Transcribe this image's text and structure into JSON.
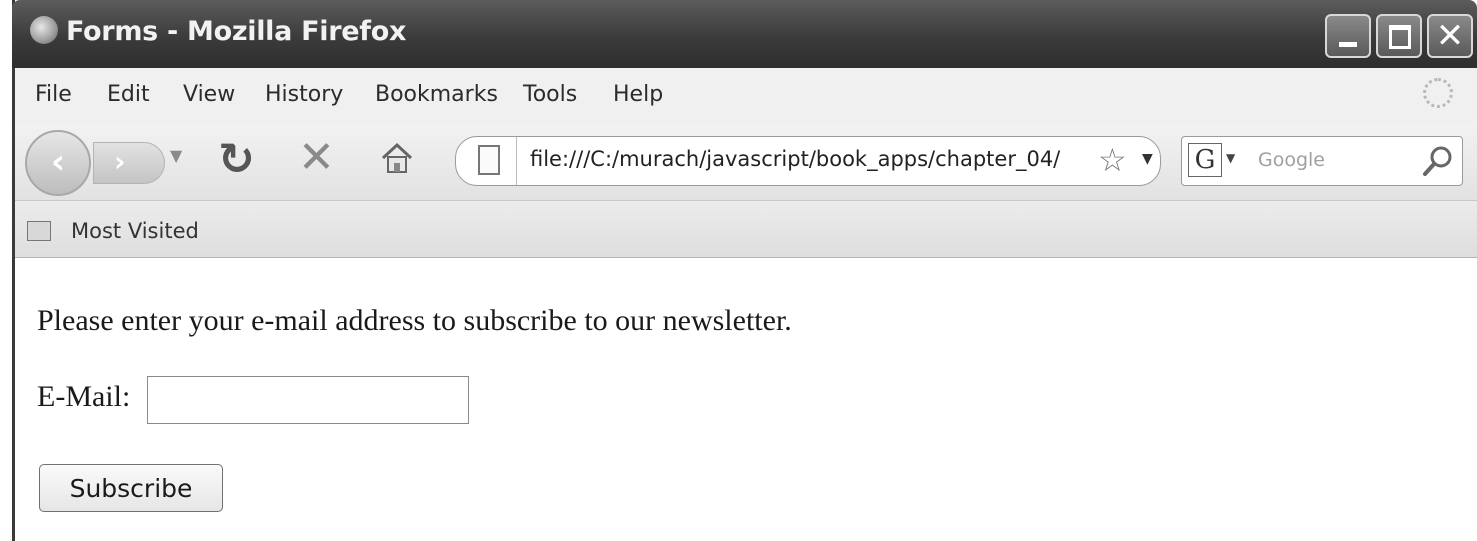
{
  "window": {
    "title": "Forms - Mozilla Firefox"
  },
  "menu": {
    "items": [
      "File",
      "Edit",
      "View",
      "History",
      "Bookmarks",
      "Tools",
      "Help"
    ]
  },
  "nav": {
    "url": "file:///C:/murach/javascript/book_apps/chapter_04/",
    "search_engine_letter": "G",
    "search_placeholder": "Google"
  },
  "bookmarks": {
    "items": [
      "Most Visited"
    ]
  },
  "page": {
    "intro": "Please enter your e-mail address to subscribe to our newsletter.",
    "email_label": "E-Mail:",
    "email_value": "",
    "subscribe_label": "Subscribe"
  }
}
